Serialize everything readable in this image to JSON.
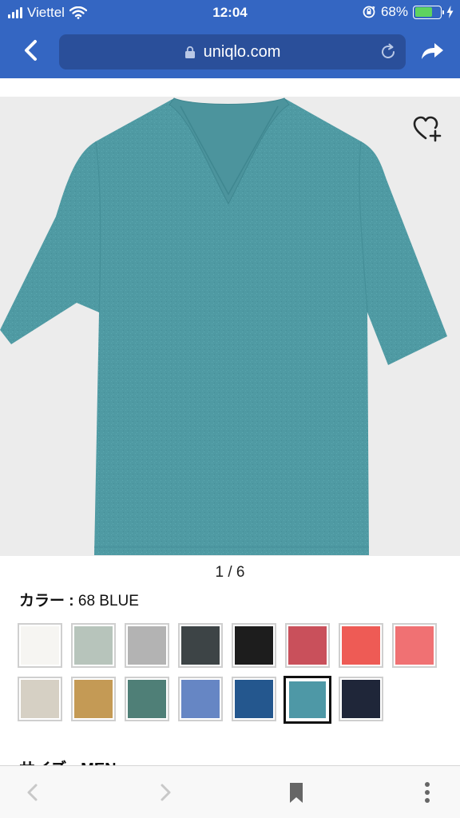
{
  "status_bar": {
    "carrier": "Viettel",
    "time": "12:04",
    "battery_percent": "68%",
    "battery_level": 0.68
  },
  "browser": {
    "url": "uniqlo.com"
  },
  "product": {
    "image_pager": "1 / 6",
    "color_key": "カラー :",
    "color_value": "68 BLUE",
    "swatches": [
      {
        "color": "#f6f5f2",
        "selected": false
      },
      {
        "color": "#b7c4bb",
        "selected": false
      },
      {
        "color": "#b3b3b3",
        "selected": false
      },
      {
        "color": "#3d4446",
        "selected": false
      },
      {
        "color": "#1d1d1d",
        "selected": false
      },
      {
        "color": "#c9505b",
        "selected": false
      },
      {
        "color": "#ee5b55",
        "selected": false
      },
      {
        "color": "#f07173",
        "selected": false
      },
      {
        "color": "#d6d0c4",
        "selected": false
      },
      {
        "color": "#c49a55",
        "selected": false
      },
      {
        "color": "#4f7f77",
        "selected": false
      },
      {
        "color": "#6686c4",
        "selected": false
      },
      {
        "color": "#24578e",
        "selected": false
      },
      {
        "color": "#4e98a6",
        "selected": true
      },
      {
        "color": "#1f2639",
        "selected": false
      }
    ],
    "next_section_partial": "サイズ : MEN"
  },
  "colors": {
    "chrome_blue": "#3466c2",
    "url_field": "#2a4f9a",
    "shirt": "#4f9aa3"
  }
}
